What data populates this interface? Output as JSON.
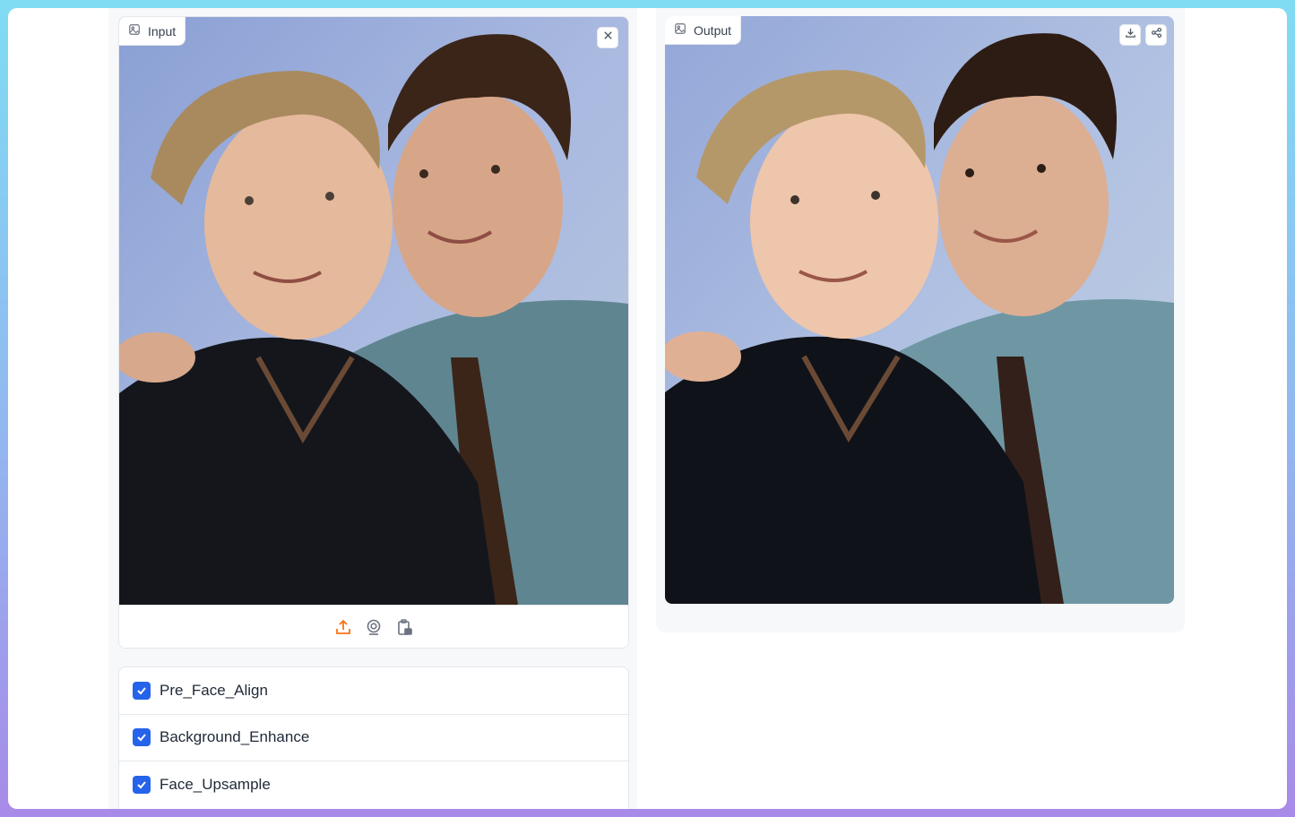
{
  "input": {
    "label": "Input",
    "icon": "image-icon",
    "clear_icon": "close-icon",
    "sources": [
      "upload-icon",
      "webcam-icon",
      "clipboard-icon"
    ],
    "accent": "#f97316"
  },
  "output": {
    "label": "Output",
    "icon": "image-icon",
    "actions": [
      "download-icon",
      "share-icon"
    ]
  },
  "options": [
    {
      "label": "Pre_Face_Align",
      "checked": true
    },
    {
      "label": "Background_Enhance",
      "checked": true
    },
    {
      "label": "Face_Upsample",
      "checked": true
    }
  ],
  "checkbox_color": "#2563eb"
}
